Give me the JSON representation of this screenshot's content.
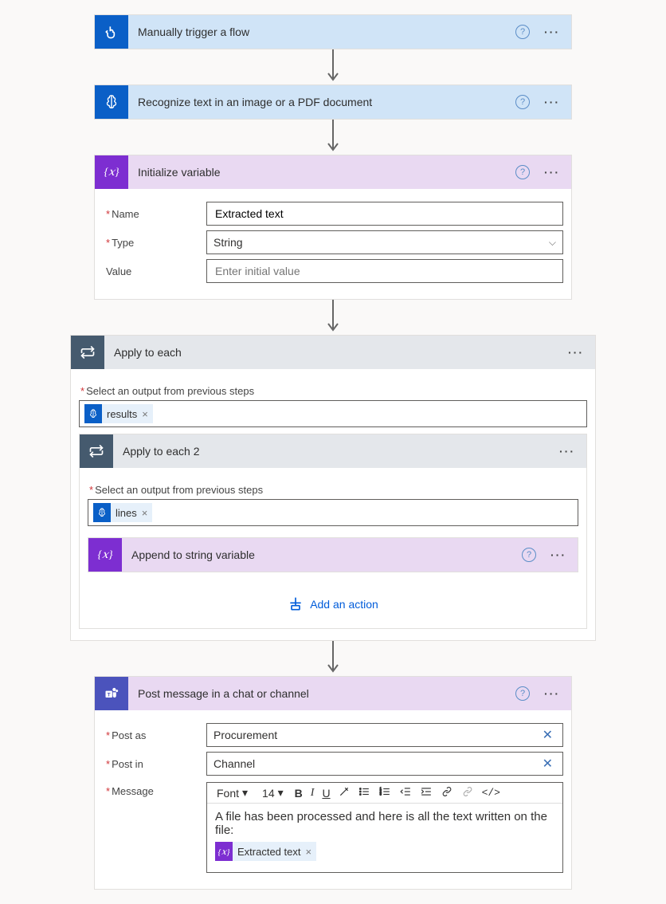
{
  "steps": {
    "trigger": {
      "title": "Manually trigger a flow"
    },
    "recognize": {
      "title": "Recognize text in an image or a PDF document"
    },
    "initVar": {
      "title": "Initialize variable",
      "nameLabel": "Name",
      "nameValue": "Extracted text",
      "typeLabel": "Type",
      "typeValue": "String",
      "valueLabel": "Value",
      "valuePlaceholder": "Enter initial value"
    },
    "applyEach": {
      "title": "Apply to each",
      "outputLabel": "Select an output from previous steps",
      "token": "results"
    },
    "applyEach2": {
      "title": "Apply to each 2",
      "outputLabel": "Select an output from previous steps",
      "token": "lines"
    },
    "append": {
      "title": "Append to string variable"
    },
    "addAction": "Add an action",
    "post": {
      "title": "Post message in a chat or channel",
      "postAsLabel": "Post as",
      "postAsValue": "Procurement",
      "postInLabel": "Post in",
      "postInValue": "Channel",
      "messageLabel": "Message",
      "fontLabel": "Font",
      "fontSize": "14",
      "messageText": "A file has been processed and here is all the text written on the file:",
      "token": "Extracted text"
    }
  }
}
